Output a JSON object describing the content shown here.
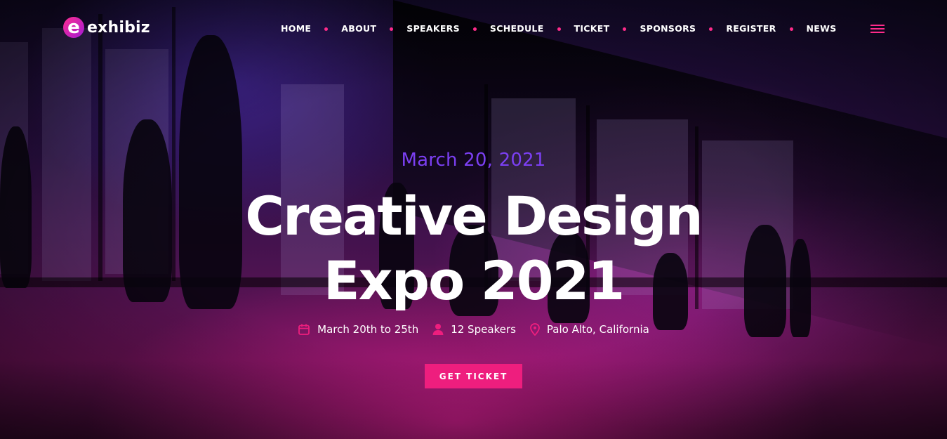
{
  "brand": {
    "name": "exhibiz",
    "mark": "e",
    "accent": "#ee1e7e",
    "date_color": "#7b3ff2"
  },
  "nav": {
    "items": [
      "HOME",
      "ABOUT",
      "SPEAKERS",
      "SCHEDULE",
      "TICKET",
      "SPONSORS",
      "REGISTER",
      "NEWS"
    ],
    "menu_icon": "hamburger-icon"
  },
  "hero": {
    "date": "March 20, 2021",
    "title_line1": "Creative Design",
    "title_line2": "Expo 2021",
    "meta": [
      {
        "icon": "calendar-icon",
        "text": "March 20th to 25th"
      },
      {
        "icon": "user-icon",
        "text": "12 Speakers"
      },
      {
        "icon": "map-pin-icon",
        "text": "Palo Alto, California"
      }
    ],
    "cta_label": "GET TICKET"
  }
}
